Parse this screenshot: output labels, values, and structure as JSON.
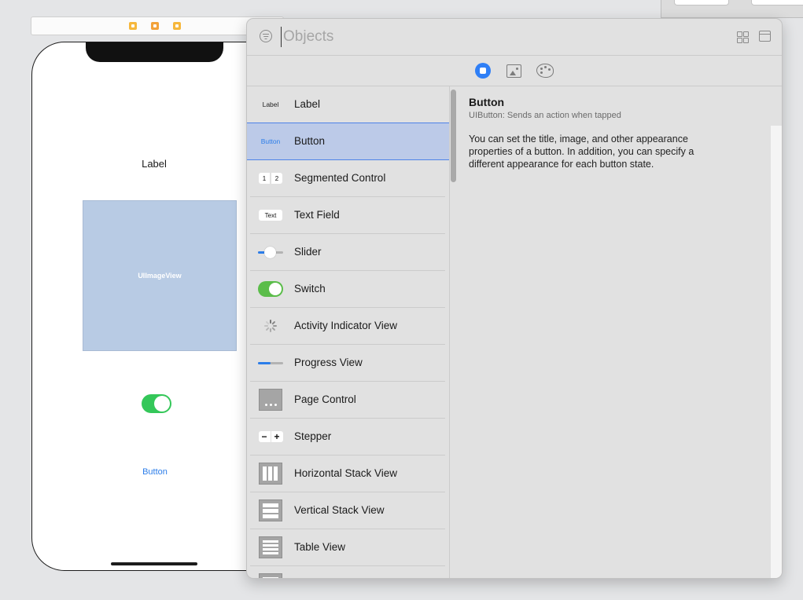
{
  "canvas": {
    "label_text": "Label",
    "image_view_text": "UIImageView",
    "button_text": "Button"
  },
  "library": {
    "search": {
      "placeholder": "Objects",
      "value": ""
    },
    "tabs": [
      {
        "name": "Objects",
        "icon": "square-circle-icon",
        "selected": true,
        "color": "#2f7ff6"
      },
      {
        "name": "Media",
        "icon": "photo-icon",
        "selected": false
      },
      {
        "name": "Colors",
        "icon": "palette-icon",
        "selected": false
      }
    ],
    "items": [
      {
        "label": "Label",
        "icon": "label-icon",
        "icon_text": "Label"
      },
      {
        "label": "Button",
        "icon": "button-icon",
        "icon_text": "Button",
        "selected": true
      },
      {
        "label": "Segmented Control",
        "icon": "segmented-control-icon",
        "icon_text": [
          "1",
          "2"
        ]
      },
      {
        "label": "Text Field",
        "icon": "text-field-icon",
        "icon_text": "Text"
      },
      {
        "label": "Slider",
        "icon": "slider-icon",
        "level": 0.25
      },
      {
        "label": "Switch",
        "icon": "switch-icon",
        "on": true
      },
      {
        "label": "Activity Indicator View",
        "icon": "activity-indicator-icon"
      },
      {
        "label": "Progress View",
        "icon": "progress-view-icon",
        "progress": 0.5
      },
      {
        "label": "Page Control",
        "icon": "page-control-icon"
      },
      {
        "label": "Stepper",
        "icon": "stepper-icon",
        "icon_text": [
          "−",
          "+"
        ]
      },
      {
        "label": "Horizontal Stack View",
        "icon": "horizontal-stack-icon"
      },
      {
        "label": "Vertical Stack View",
        "icon": "vertical-stack-icon"
      },
      {
        "label": "Table View",
        "icon": "table-view-icon"
      }
    ],
    "detail": {
      "title": "Button",
      "subtitle": "UIButton: Sends an action when tapped",
      "description": "You can set the title, image, and other appearance properties of a button. In addition, you can specify a different appearance for each button state."
    }
  },
  "colors": {
    "accent": "#2f7ff6",
    "selection": "#bccae8",
    "switch_green": "#34c759"
  }
}
